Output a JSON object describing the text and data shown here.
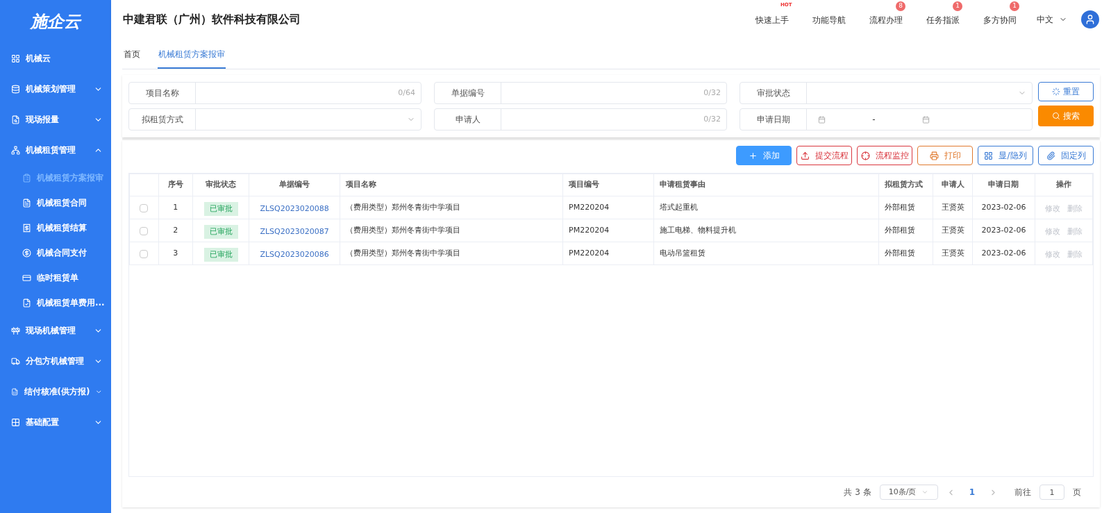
{
  "logo": {
    "text": "施企云"
  },
  "sidebar": {
    "items": [
      {
        "label": "机械云",
        "kind": "link"
      },
      {
        "label": "机械策划管理",
        "kind": "group",
        "expanded": false
      },
      {
        "label": "现场报量",
        "kind": "group",
        "expanded": false
      },
      {
        "label": "机械租赁管理",
        "kind": "group",
        "expanded": true,
        "children": [
          {
            "label": "机械租赁方案报审",
            "selected": true
          },
          {
            "label": "机械租赁合同",
            "selected": false
          },
          {
            "label": "机械租赁结算",
            "selected": false
          },
          {
            "label": "机械合同支付",
            "selected": false
          },
          {
            "label": "临时租赁单",
            "selected": false
          },
          {
            "label": "机械租赁单费用...",
            "selected": false
          }
        ]
      },
      {
        "label": "现场机械管理",
        "kind": "group",
        "expanded": false
      },
      {
        "label": "分包方机械管理",
        "kind": "group",
        "expanded": false
      },
      {
        "label": "结付核准(供方报)",
        "kind": "group",
        "expanded": false
      },
      {
        "label": "基础配置",
        "kind": "group",
        "expanded": false
      }
    ]
  },
  "header": {
    "company": "中建君联（广州）软件科技有限公司",
    "nav": [
      {
        "label": "快速上手",
        "hot": "HOT"
      },
      {
        "label": "功能导航"
      },
      {
        "label": "流程办理",
        "badge": "8"
      },
      {
        "label": "任务指派",
        "badge": "1"
      },
      {
        "label": "多方协同",
        "badge": "1"
      }
    ],
    "language": "中文"
  },
  "tabs": [
    {
      "label": "首页",
      "selected": false
    },
    {
      "label": "机械租赁方案报审",
      "selected": true
    }
  ],
  "filters": [
    {
      "label": "项目名称",
      "kind": "text",
      "counter": "0/64"
    },
    {
      "label": "单据编号",
      "kind": "text",
      "counter": "0/32"
    },
    {
      "label": "审批状态",
      "kind": "select"
    },
    {
      "label": "拟租赁方式",
      "kind": "select"
    },
    {
      "label": "申请人",
      "kind": "text",
      "counter": "0/32"
    },
    {
      "label": "申请日期",
      "kind": "date",
      "separator": "-"
    }
  ],
  "filter_buttons": [
    {
      "label": "重置",
      "kind": "reset"
    },
    {
      "label": "搜索",
      "kind": "search"
    }
  ],
  "toolbar": [
    {
      "label": "添加",
      "kind": "add"
    },
    {
      "label": "提交流程",
      "kind": "submit"
    },
    {
      "label": "流程监控",
      "kind": "monitor"
    },
    {
      "label": "打印",
      "kind": "print"
    },
    {
      "label": "显/隐列",
      "kind": "columns"
    },
    {
      "label": "固定列",
      "kind": "pin"
    }
  ],
  "table": {
    "columns": [
      "序号",
      "审批状态",
      "单据编号",
      "项目名称",
      "项目编号",
      "申请租赁事由",
      "拟租赁方式",
      "申请人",
      "申请日期",
      "操作"
    ],
    "rows": [
      {
        "checked": false,
        "no": "1",
        "status": "已审批",
        "code": "ZLSQ2023020088",
        "project": "（费用类型）郑州冬青街中学项目",
        "project_code": "PM220204",
        "reason": "塔式起重机",
        "method": "外部租赁",
        "applicant": "王贤英",
        "date": "2023-02-06",
        "actions": [
          "修改",
          "删除"
        ]
      },
      {
        "checked": false,
        "no": "2",
        "status": "已审批",
        "code": "ZLSQ2023020087",
        "project": "（费用类型）郑州冬青街中学项目",
        "project_code": "PM220204",
        "reason": "施工电梯、物料提升机",
        "method": "外部租赁",
        "applicant": "王贤英",
        "date": "2023-02-06",
        "actions": [
          "修改",
          "删除"
        ]
      },
      {
        "checked": false,
        "no": "3",
        "status": "已审批",
        "code": "ZLSQ2023020086",
        "project": "（费用类型）郑州冬青街中学项目",
        "project_code": "PM220204",
        "reason": "电动吊篮租赁",
        "method": "外部租赁",
        "applicant": "王贤英",
        "date": "2023-02-06",
        "actions": [
          "修改",
          "删除"
        ]
      }
    ]
  },
  "pagination": {
    "total": "共 3 条",
    "page_size": "10条/页",
    "pages": [
      {
        "label": "1",
        "selected": true
      }
    ],
    "goto_label": "前往",
    "goto_value": "1",
    "goto_suffix": "页"
  }
}
